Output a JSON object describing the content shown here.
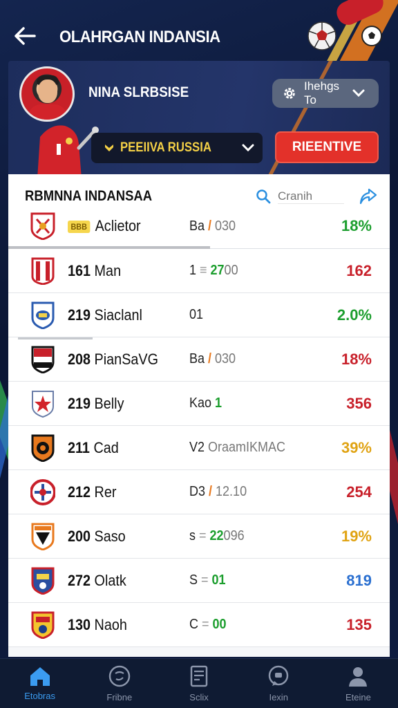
{
  "header": {
    "title": "OLAHRGAN INDANSIA"
  },
  "hero": {
    "player_name": "NINA SLRBSISE",
    "sort_label": "Ihehgs To",
    "team_label": "PEEIIVA RUSSIA",
    "action_label": "RIEENTIVE"
  },
  "panel": {
    "title": "RBMNNA INDANSAA",
    "search_placeholder": "Cranih"
  },
  "first_row": {
    "badge": "BBB",
    "name": "Aclietor",
    "mid_a": "Ba",
    "mid_b": "030",
    "stat": "18%",
    "stat_color": "#1c9e2e"
  },
  "rows": [
    {
      "rank": "161",
      "name": "Man",
      "mid_pre": "1",
      "mid_sep": "≡",
      "mid_green": "27",
      "mid_post": "00",
      "stat": "162",
      "stat_color": "#c8202a",
      "crest": "red-white"
    },
    {
      "rank": "219",
      "name": "Siaclanl",
      "mid_pre": "01",
      "mid_sep": "",
      "mid_green": "",
      "mid_post": "",
      "stat": "2.0%",
      "stat_color": "#1c9e2e",
      "crest": "blue-shield"
    },
    {
      "rank": "208",
      "name": "PianSaVG",
      "mid_pre": "Ba",
      "mid_sep": "/",
      "mid_green": "",
      "mid_post": "030",
      "stat": "18%",
      "stat_color": "#c8202a",
      "crest": "red-black"
    },
    {
      "rank": "219",
      "name": "Belly",
      "mid_pre": "Kao",
      "mid_sep": "",
      "mid_green": "1",
      "mid_post": "",
      "stat": "356",
      "stat_color": "#c8202a",
      "crest": "red-star"
    },
    {
      "rank": "211",
      "name": "Cad",
      "mid_pre": "V2",
      "mid_sep": "",
      "mid_green": "",
      "mid_post": "OraamIKMAC",
      "stat": "39%",
      "stat_color": "#e0a313",
      "crest": "orange-black"
    },
    {
      "rank": "212",
      "name": "Rer",
      "mid_pre": "D3",
      "mid_sep": "/",
      "mid_green": "",
      "mid_post": "12.10",
      "stat": "254",
      "stat_color": "#c8202a",
      "crest": "red-circle"
    },
    {
      "rank": "200",
      "name": "Saso",
      "mid_pre": "s",
      "mid_sep": "=",
      "mid_green": "22",
      "mid_post": "096",
      "stat": "19%",
      "stat_color": "#e0a313",
      "crest": "orange-shield"
    },
    {
      "rank": "272",
      "name": "Olatk",
      "mid_pre": "S",
      "mid_sep": "=",
      "mid_green": "01",
      "mid_post": "",
      "stat": "819",
      "stat_color": "#2a6fd0",
      "crest": "blue-red"
    },
    {
      "rank": "130",
      "name": "Naoh",
      "mid_pre": "C",
      "mid_sep": "=",
      "mid_green": "00",
      "mid_post": "",
      "stat": "135",
      "stat_color": "#c8202a",
      "crest": "yellow-red"
    }
  ],
  "nav": [
    {
      "label": "Etobras",
      "icon": "home-icon",
      "active": true
    },
    {
      "label": "Fribne",
      "icon": "ball-icon",
      "active": false
    },
    {
      "label": "Sclix",
      "icon": "card-icon",
      "active": false
    },
    {
      "label": "Iexin",
      "icon": "chat-icon",
      "active": false
    },
    {
      "label": "Eteine",
      "icon": "profile-icon",
      "active": false
    }
  ],
  "colors": {
    "accent_blue": "#3b9cf1",
    "action_red": "#e3312a",
    "team_yellow": "#f4d046",
    "stat_green": "#1c9e2e",
    "stat_red": "#c8202a",
    "stat_orange": "#e0a313"
  }
}
